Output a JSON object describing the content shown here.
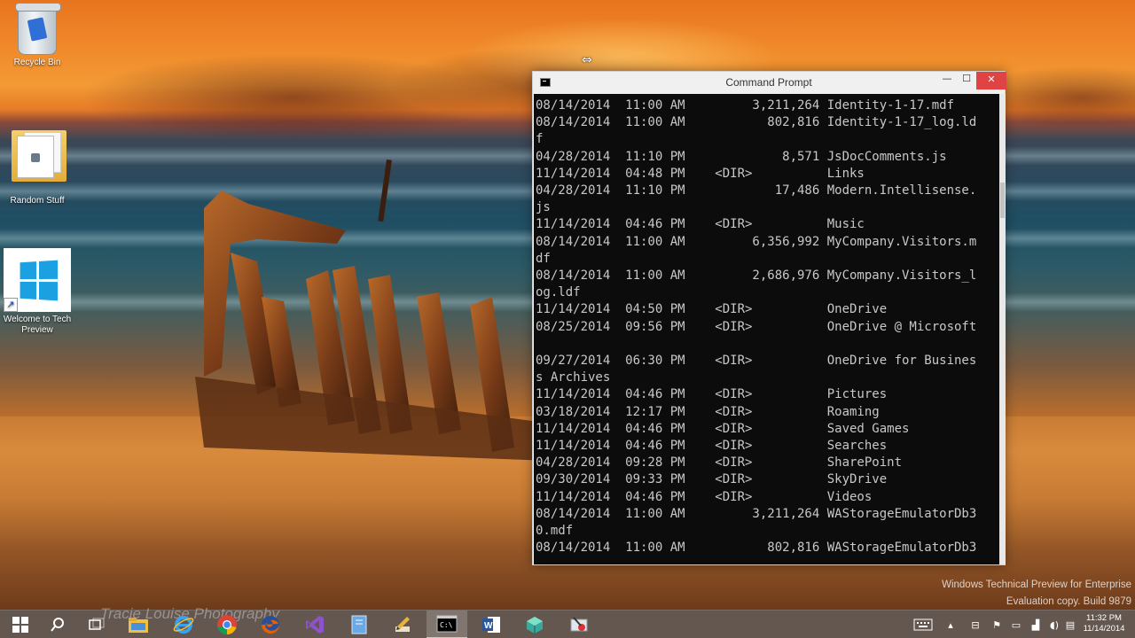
{
  "desktop": {
    "icons": [
      {
        "label": "Recycle Bin",
        "icon": "recycle-bin-icon"
      },
      {
        "label": "Random Stuff",
        "icon": "folder-icon"
      },
      {
        "label": "Welcome to Tech Preview",
        "icon": "windows-logo-icon"
      }
    ],
    "watermark": "Tracie Louise Photography",
    "evaluation": {
      "line1": "Windows Technical Preview for Enterprise",
      "line2": "Evaluation copy. Build 9879"
    }
  },
  "cmd": {
    "title": "Command Prompt",
    "lines": [
      "08/14/2014  11:00 AM         3,211,264 Identity-1-17.mdf",
      "08/14/2014  11:00 AM           802,816 Identity-1-17_log.ld",
      "f",
      "04/28/2014  11:10 PM             8,571 JsDocComments.js",
      "11/14/2014  04:48 PM    <DIR>          Links",
      "04/28/2014  11:10 PM            17,486 Modern.Intellisense.",
      "js",
      "11/14/2014  04:46 PM    <DIR>          Music",
      "08/14/2014  11:00 AM         6,356,992 MyCompany.Visitors.m",
      "df",
      "08/14/2014  11:00 AM         2,686,976 MyCompany.Visitors_l",
      "og.ldf",
      "11/14/2014  04:50 PM    <DIR>          OneDrive",
      "08/25/2014  09:56 PM    <DIR>          OneDrive @ Microsoft",
      "",
      "09/27/2014  06:30 PM    <DIR>          OneDrive for Busines",
      "s Archives",
      "11/14/2014  04:46 PM    <DIR>          Pictures",
      "03/18/2014  12:17 PM    <DIR>          Roaming",
      "11/14/2014  04:46 PM    <DIR>          Saved Games",
      "11/14/2014  04:46 PM    <DIR>          Searches",
      "04/28/2014  09:28 PM    <DIR>          SharePoint",
      "09/30/2014  09:33 PM    <DIR>          SkyDrive",
      "11/14/2014  04:46 PM    <DIR>          Videos",
      "08/14/2014  11:00 AM         3,211,264 WAStorageEmulatorDb3",
      "0.mdf",
      "08/14/2014  11:00 AM           802,816 WAStorageEmulatorDb3"
    ],
    "colors": {
      "background": "#0c0c0c",
      "text": "#c8c8c8",
      "close": "#e04343"
    }
  },
  "taskbar": {
    "items": [
      {
        "icon": "start-icon",
        "active": false
      },
      {
        "icon": "search-icon",
        "active": false
      },
      {
        "icon": "task-view-icon",
        "active": false
      },
      {
        "icon": "file-explorer-icon",
        "active": false
      },
      {
        "icon": "internet-explorer-icon",
        "active": false
      },
      {
        "icon": "chrome-icon",
        "active": false
      },
      {
        "icon": "firefox-icon",
        "active": false
      },
      {
        "icon": "visual-studio-icon",
        "active": false
      },
      {
        "icon": "notebook-icon",
        "active": false
      },
      {
        "icon": "pen-icon",
        "active": false
      },
      {
        "icon": "command-prompt-icon",
        "active": true
      },
      {
        "icon": "word-icon",
        "active": false
      },
      {
        "icon": "cube-app-icon",
        "active": false
      },
      {
        "icon": "snipping-tool-icon",
        "active": false
      }
    ],
    "tray_icons": [
      "keyboard-icon",
      "chevron-up-icon",
      "network-icon",
      "flag-icon",
      "battery-icon",
      "signal-icon",
      "volume-icon",
      "action-center-icon"
    ],
    "clock": {
      "time": "11:32 PM",
      "date": "11/14/2014"
    }
  }
}
